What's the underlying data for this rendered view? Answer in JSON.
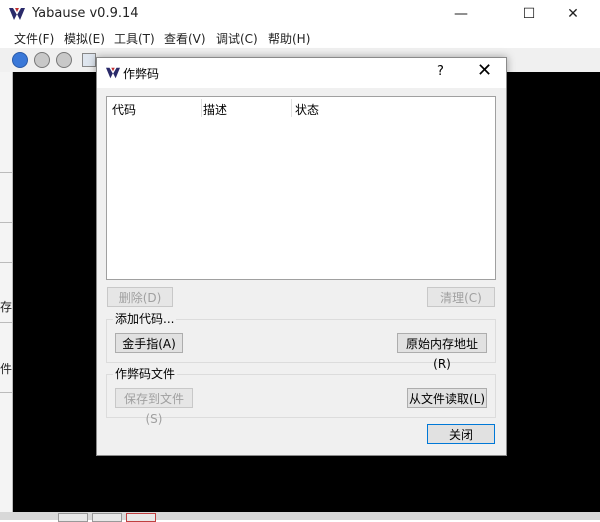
{
  "app": {
    "title": "Yabause v0.9.14",
    "minimize": "—",
    "maximize": "☐",
    "close": "✕"
  },
  "menu": [
    "文件(F)",
    "模拟(E)",
    "工具(T)",
    "查看(V)",
    "调试(C)",
    "帮助(H)"
  ],
  "left_strip_chars": [
    "存",
    "件"
  ],
  "dialog": {
    "title": "作弊码",
    "help": "?",
    "close": "✕",
    "columns": [
      "代码",
      "描述",
      "状态"
    ],
    "delete_button": "删除(D)",
    "clear_button": "清理(C)",
    "add_group": {
      "label": "添加代码...",
      "gameshark_button": "金手指(A)",
      "raw_address_button": "原始内存地址(R)"
    },
    "file_group": {
      "label": "作弊码文件",
      "save_button": "保存到文件(S)",
      "load_button": "从文件读取(L)"
    },
    "close_button": "关闭"
  }
}
